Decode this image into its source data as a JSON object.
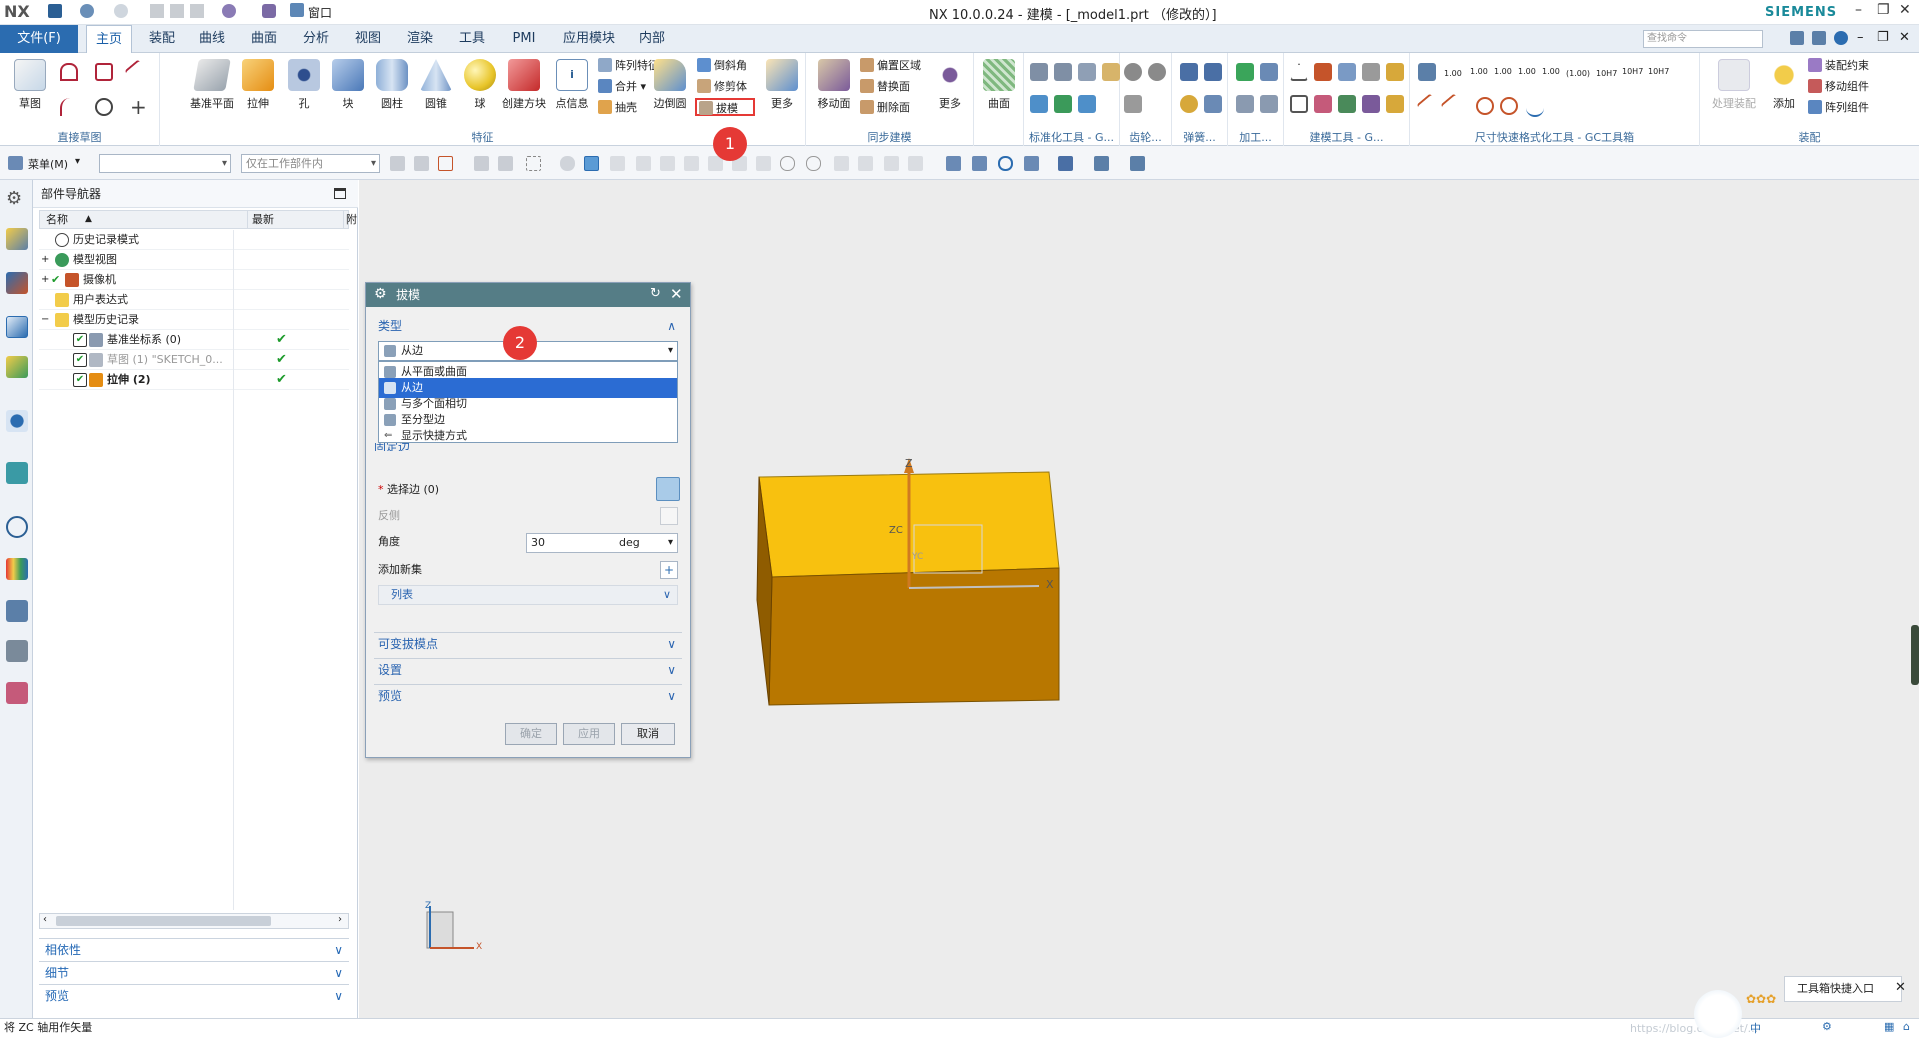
{
  "window": {
    "app_logo": "NX",
    "title": "NX 10.0.0.24 - 建模 - [_model1.prt （修改的）]",
    "brand": "SIEMENS",
    "quick_toolbar": {
      "window_menu": "窗口"
    }
  },
  "menu_tabs": {
    "file": "文件(F)",
    "tabs": [
      "主页",
      "装配",
      "曲线",
      "曲面",
      "分析",
      "视图",
      "渲染",
      "工具",
      "PMI",
      "应用模块",
      "内部"
    ],
    "active_tab": "主页",
    "search_placeholder": "查找命令"
  },
  "ribbon": {
    "groups": [
      {
        "label": "直接草图",
        "buttons": [
          "草图"
        ]
      },
      {
        "label": "特征",
        "buttons": [
          "基准平面",
          "拉伸",
          "孔",
          "块",
          "圆柱",
          "圆锥",
          "球",
          "创建方块",
          "点信息",
          "边倒圆",
          "更多"
        ],
        "small": [
          "阵列特征",
          "合并",
          "抽壳",
          "倒斜角",
          "修剪体",
          "拔模"
        ]
      },
      {
        "label": "同步建模",
        "buttons": [
          "移动面",
          "更多"
        ],
        "small": [
          "偏置区域",
          "替换面",
          "删除面"
        ]
      },
      {
        "label": "",
        "buttons": [
          "曲面"
        ]
      },
      {
        "label": "标准化工具 - G...",
        "buttons": []
      },
      {
        "label": "齿轮...",
        "buttons": []
      },
      {
        "label": "弹簧...",
        "buttons": []
      },
      {
        "label": "加工...",
        "buttons": []
      },
      {
        "label": "建模工具 - G...",
        "buttons": []
      },
      {
        "label": "尺寸快速格式化工具 - GC工具箱",
        "buttons": []
      },
      {
        "label": "装配",
        "buttons": [
          "处理装配",
          "添加"
        ],
        "small": [
          "装配约束",
          "移动组件",
          "阵列组件"
        ]
      }
    ],
    "dimension_labels": [
      "1.00",
      "1.00",
      "1.00",
      "1.00",
      "1.00",
      "(1.00)",
      "10H7",
      "10H7",
      "10H7"
    ]
  },
  "selection_bar": {
    "menu": "菜单(M)",
    "filter_value": "",
    "scope": "仅在工作部件内"
  },
  "part_navigator": {
    "title": "部件导航器",
    "columns": [
      "名称",
      "最新",
      "附"
    ],
    "rows": [
      {
        "label": "历史记录模式",
        "depth": 1,
        "checked": false,
        "latest": false
      },
      {
        "label": "模型视图",
        "depth": 1,
        "checked": false,
        "latest": false
      },
      {
        "label": "摄像机",
        "depth": 1,
        "checked": true,
        "latest": false
      },
      {
        "label": "用户表达式",
        "depth": 1,
        "checked": false,
        "latest": false
      },
      {
        "label": "模型历史记录",
        "depth": 1,
        "checked": false,
        "latest": false
      },
      {
        "label": "基准坐标系 (0)",
        "depth": 2,
        "checked": true,
        "latest": true
      },
      {
        "label": "草图 (1) \"SKETCH_0...",
        "depth": 2,
        "checked": true,
        "latest": true
      },
      {
        "label": "拉伸 (2)",
        "depth": 2,
        "checked": true,
        "latest": true
      }
    ],
    "sections": [
      "相依性",
      "细节",
      "预览"
    ]
  },
  "draft_dialog": {
    "title": "拔模",
    "type_section": "类型",
    "type_value": "从边",
    "type_options": [
      "从平面或曲面",
      "从边",
      "与多个面相切",
      "至分型边",
      "显示快捷方式"
    ],
    "selected_option_index": 1,
    "edge_section_partial": "固定边",
    "select_edge": "选择边 (0)",
    "reverse": "反侧",
    "angle_label": "角度",
    "angle_value": "30",
    "angle_unit": "deg",
    "add_set": "添加新集",
    "list": "列表",
    "sections": [
      "可变拔模点",
      "设置",
      "预览"
    ],
    "buttons": {
      "ok": "确定",
      "apply": "应用",
      "cancel": "取消"
    }
  },
  "annotations": {
    "marker1": "1",
    "marker2": "2"
  },
  "viewport": {
    "axis_labels": {
      "z": "Z",
      "x": "X",
      "zc": "ZC",
      "yc": "YC"
    },
    "mini_triad": {
      "z": "Z",
      "x": "X"
    },
    "box_top_color": "#f8c10f",
    "box_side_color": "#b87700"
  },
  "status_bar": {
    "message": "将 ZC 轴用作矢量",
    "tool_popup": "工具箱快捷入口",
    "watermark": "https://blog.csdn.net/..."
  },
  "colors": {
    "file_button": "#2b6cb0",
    "dialog_title": "#557d86",
    "selection_highlight": "#2b6cd3",
    "marker": "#e53935",
    "check_green": "#1e9b2c"
  }
}
